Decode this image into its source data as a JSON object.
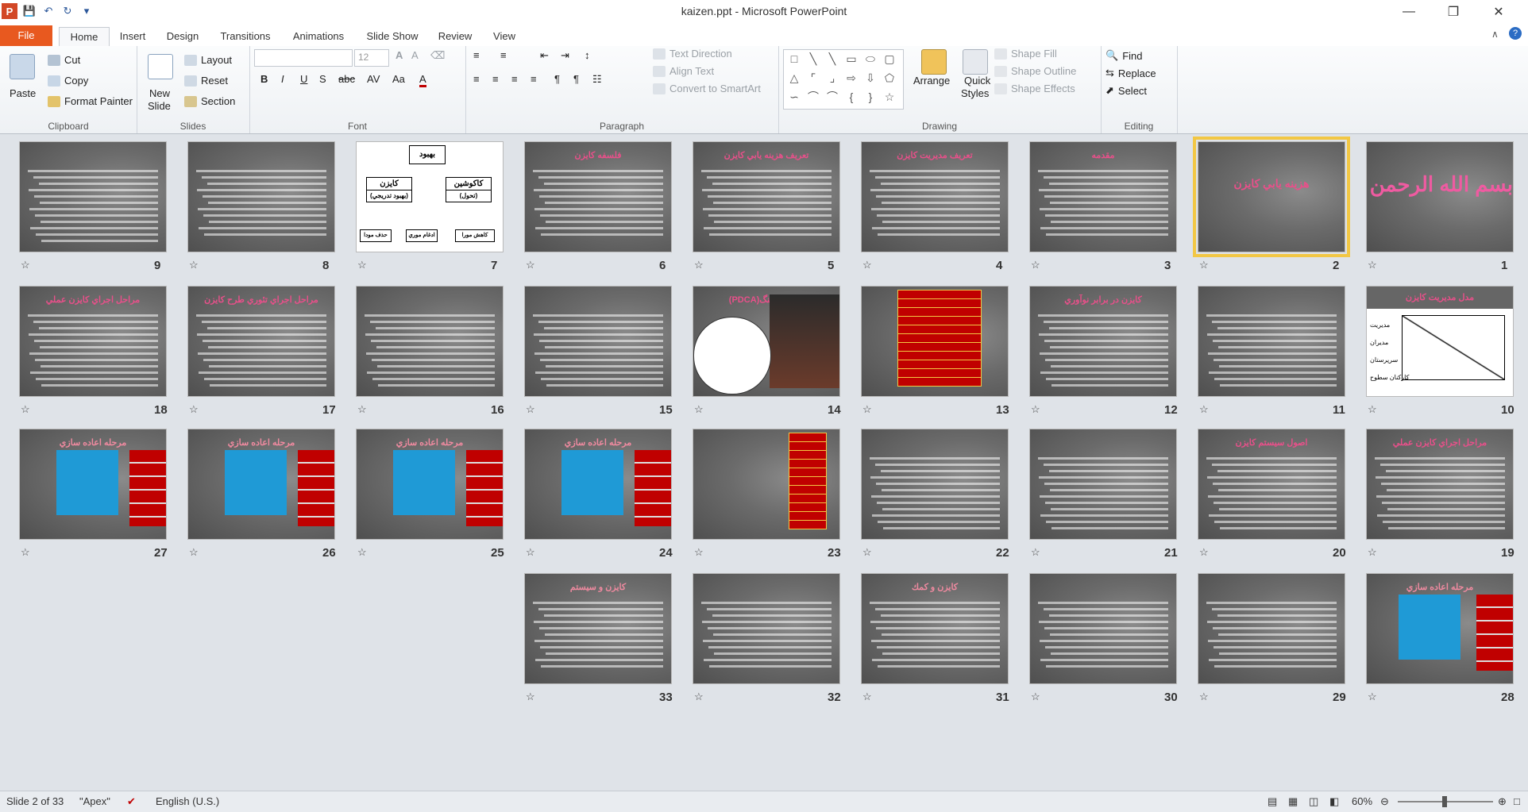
{
  "window": {
    "title": "kaizen.ppt  -  Microsoft PowerPoint",
    "quick_access": [
      "save-icon",
      "undo-icon",
      "redo-icon",
      "customize-icon"
    ]
  },
  "tabs": [
    "File",
    "Home",
    "Insert",
    "Design",
    "Transitions",
    "Animations",
    "Slide Show",
    "Review",
    "View"
  ],
  "active_tab": "Home",
  "ribbon": {
    "clipboard": {
      "paste": "Paste",
      "cut": "Cut",
      "copy": "Copy",
      "format_painter": "Format Painter",
      "label": "Clipboard"
    },
    "slides": {
      "new_slide": "New",
      "new_slide2": "Slide",
      "layout": "Layout",
      "reset": "Reset",
      "section": "Section",
      "label": "Slides"
    },
    "font": {
      "size": "12",
      "label": "Font"
    },
    "paragraph": {
      "text_direction": "Text Direction",
      "align_text": "Align Text",
      "convert_smartart": "Convert to SmartArt",
      "label": "Paragraph"
    },
    "drawing": {
      "arrange": "Arrange",
      "quick_styles": "Quick",
      "quick_styles2": "Styles",
      "shape_fill": "Shape Fill",
      "shape_outline": "Shape Outline",
      "shape_effects": "Shape Effects",
      "label": "Drawing"
    },
    "editing": {
      "find": "Find",
      "replace": "Replace",
      "select": "Select",
      "label": "Editing"
    }
  },
  "slides": [
    {
      "n": "1",
      "title": "بسم الله الرحمن الرحيم"
    },
    {
      "n": "2",
      "title": "هزينه يابي كايزن"
    },
    {
      "n": "3",
      "title": "مقدمه"
    },
    {
      "n": "4",
      "title": "تعريف مديريت كايزن"
    },
    {
      "n": "5",
      "title": "تعريف هزينه يابي كايزن"
    },
    {
      "n": "6",
      "title": "فلسفه كايزن"
    },
    {
      "n": "7",
      "title": "بهبود"
    },
    {
      "n": "8",
      "title": ""
    },
    {
      "n": "9",
      "title": ""
    },
    {
      "n": "10",
      "title": "مدل مديريت كايزن"
    },
    {
      "n": "11",
      "title": ""
    },
    {
      "n": "12",
      "title": "كايزن در برابر نوآوري"
    },
    {
      "n": "13",
      "title": ""
    },
    {
      "n": "14",
      "title": "چرخه دمينگ(PDCA)"
    },
    {
      "n": "15",
      "title": ""
    },
    {
      "n": "16",
      "title": ""
    },
    {
      "n": "17",
      "title": "مراحل اجراي تئوري طرح كايزن"
    },
    {
      "n": "18",
      "title": "مراحل اجراي كايزن عملي"
    },
    {
      "n": "19",
      "title": "مراحل اجراي كايزن عملي"
    },
    {
      "n": "20",
      "title": "اصول سيستم كايزن"
    },
    {
      "n": "21",
      "title": ""
    },
    {
      "n": "22",
      "title": ""
    },
    {
      "n": "23",
      "title": ""
    },
    {
      "n": "24",
      "title": "مرحله اعاده سازي"
    },
    {
      "n": "25",
      "title": "مرحله اعاده سازي"
    },
    {
      "n": "26",
      "title": "مرحله اعاده سازي"
    },
    {
      "n": "27",
      "title": "مرحله اعاده سازي"
    },
    {
      "n": "28",
      "title": "مرحله اعاده سازي"
    },
    {
      "n": "29",
      "title": ""
    },
    {
      "n": "30",
      "title": ""
    },
    {
      "n": "31",
      "title": "كايزن و كمك"
    },
    {
      "n": "32",
      "title": ""
    },
    {
      "n": "33",
      "title": "كايزن و سيستم"
    }
  ],
  "slide7": {
    "top": "بهبود",
    "left": "كايزن",
    "left_sub": "(بهبود تدريجي)",
    "right": "كاكوشين",
    "right_sub": "(تحول)",
    "b1": "حذف مودا",
    "b2": "ادغام موري",
    "b3": "كاهش مورا"
  },
  "slide10": {
    "r1": "مديريت",
    "r2": "مديران",
    "r3": "سرپرستان",
    "r4": "كاركنان سطوح"
  },
  "status": {
    "slide_info": "Slide 2 of 33",
    "theme": "\"Apex\"",
    "language": "English (U.S.)",
    "zoom": "60%"
  }
}
